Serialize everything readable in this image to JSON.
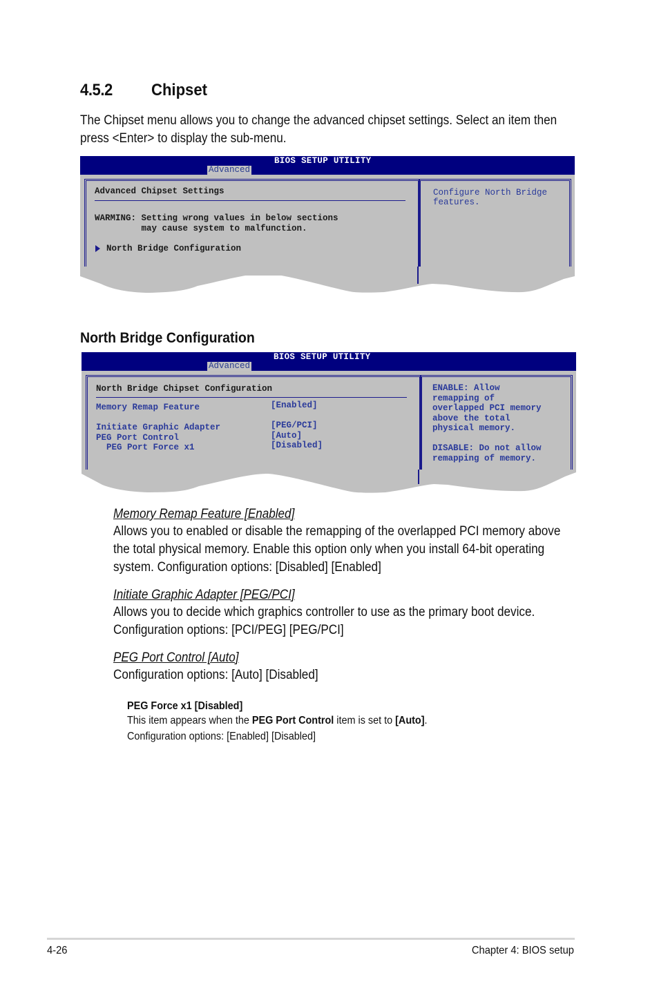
{
  "section": {
    "number": "4.5.2",
    "title": "Chipset",
    "intro": "The Chipset menu allows you to change the advanced chipset settings. Select an item then press <Enter> to display the sub-menu."
  },
  "bios1": {
    "title": "BIOS SETUP UTILITY",
    "tab": "Advanced",
    "panel_title": "Advanced Chipset Settings",
    "warning_line1": "WARMING: Setting wrong values in below sections",
    "warning_line2": "         may cause system to malfunction.",
    "submenu_item": "North Bridge Configuration",
    "help_line1": "Configure North Bridge",
    "help_line2": "features."
  },
  "subsection": {
    "title": "North Bridge Configuration"
  },
  "bios2": {
    "title": "BIOS SETUP UTILITY",
    "tab": "Advanced",
    "panel_title": "North Bridge Chipset Configuration",
    "items": [
      {
        "label": "Memory Remap Feature",
        "value": "[Enabled]"
      },
      {
        "label": "Initiate Graphic Adapter",
        "value": "[PEG/PCI]"
      },
      {
        "label": "PEG Port Control",
        "value": "[Auto]"
      },
      {
        "label": "  PEG Port Force x1",
        "value": "[Disabled]"
      }
    ],
    "help_lines": [
      "ENABLE: Allow",
      "remapping of",
      "overlapped PCI memory",
      "above the total",
      "physical memory.",
      "",
      "DISABLE: Do not allow",
      "remapping of memory."
    ]
  },
  "descriptions": [
    {
      "heading": "Memory Remap Feature [Enabled]",
      "text": "Allows you to enabled or disable the remapping of the overlapped PCI memory above the total physical memory. Enable this option only when you install 64-bit operating system. Configuration options: [Disabled] [Enabled]"
    },
    {
      "heading": "Initiate Graphic Adapter [PEG/PCI]",
      "text": "Allows you to decide which graphics controller to use as the primary boot device. Configuration options: [PCI/PEG] [PEG/PCI]"
    },
    {
      "heading": "PEG Port Control [Auto]",
      "text": "Configuration options: [Auto] [Disabled]"
    }
  ],
  "sub_description": {
    "heading": "PEG Force x1 [Disabled]",
    "text_pre": "This item appears when the ",
    "text_bold1": "PEG Port Control",
    "text_mid": " item is set to ",
    "text_bold2": "[Auto]",
    "text_post": ".",
    "options": "Configuration options: [Enabled] [Disabled]"
  },
  "footer": {
    "page": "4-26",
    "chapter": "Chapter 4: BIOS setup"
  }
}
